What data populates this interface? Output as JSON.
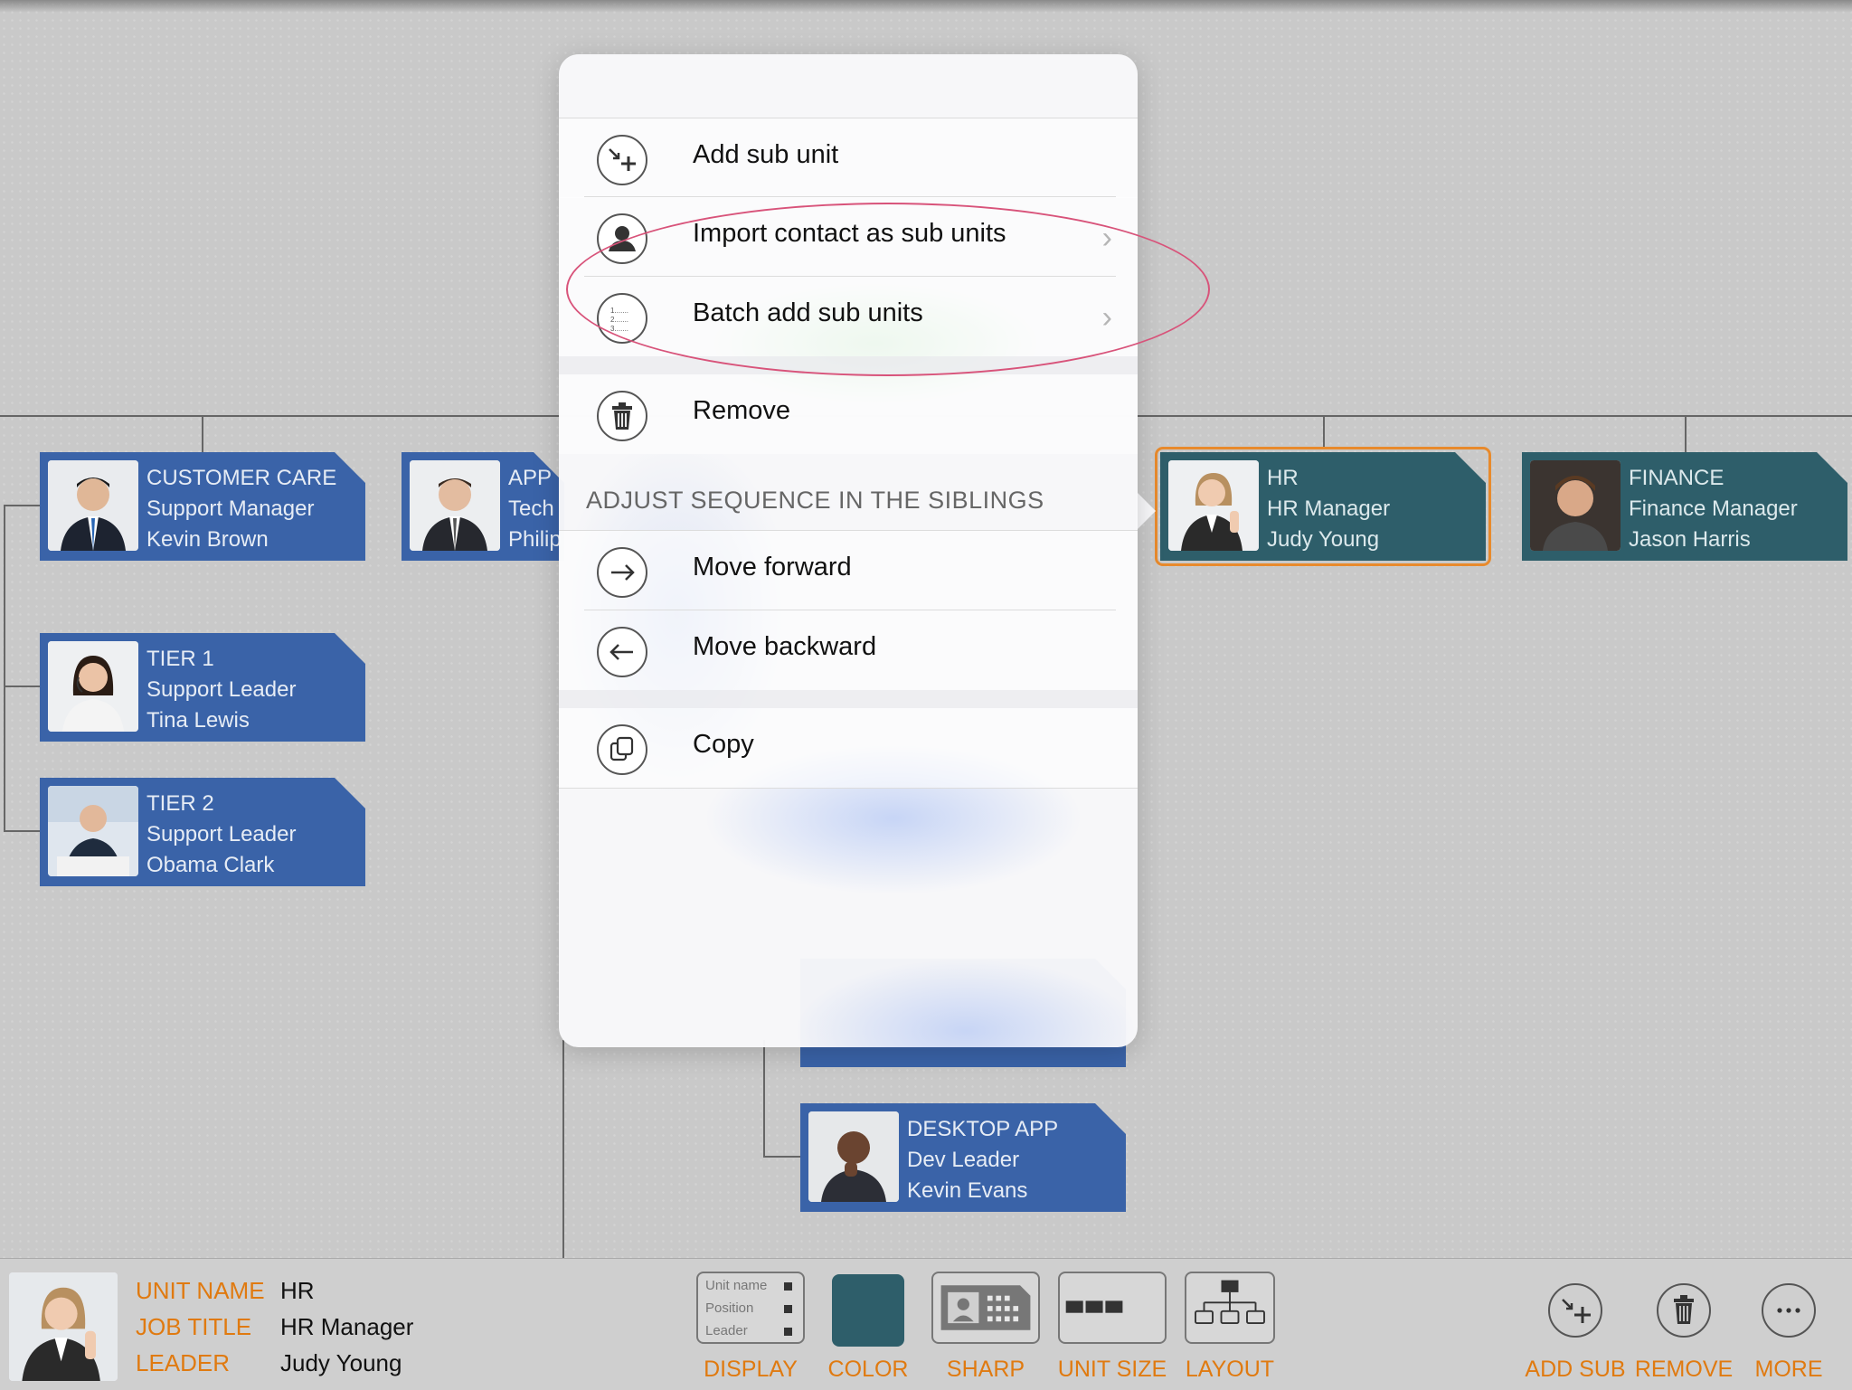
{
  "org": {
    "cards": [
      {
        "unit": "CUSTOMER CARE",
        "position": "Support Manager",
        "leader": "Kevin Brown"
      },
      {
        "unit": "APP",
        "position": "Tech",
        "leader": "Philip"
      },
      {
        "unit": "TIER 1",
        "position": "Support Leader",
        "leader": "Tina Lewis"
      },
      {
        "unit": "TIER 2",
        "position": "Support Leader",
        "leader": "Obama Clark"
      },
      {
        "unit": "HR",
        "position": "HR Manager",
        "leader": "Judy Young"
      },
      {
        "unit": "FINANCE",
        "position": "Finance Manager",
        "leader": "Jason Harris"
      },
      {
        "unit": "DESKTOP APP",
        "position": "Dev Leader",
        "leader": "Kevin Evans"
      }
    ]
  },
  "popover": {
    "items": {
      "add_sub_unit": "Add sub unit",
      "import_contact": "Import contact as sub units",
      "batch_add": "Batch add sub units",
      "remove": "Remove",
      "move_forward": "Move forward",
      "move_backward": "Move backward",
      "copy": "Copy"
    },
    "section_header": "ADJUST SEQUENCE IN THE SIBLINGS"
  },
  "bottombar": {
    "unit_name_key": "UNIT NAME",
    "unit_name_val": "HR",
    "job_title_key": "JOB TITLE",
    "job_title_val": "HR Manager",
    "leader_key": "LEADER",
    "leader_val": "Judy Young",
    "display_preview": {
      "line1": "Unit name",
      "line2": "Position",
      "line3": "Leader"
    },
    "tools": {
      "display": "DISPLAY",
      "color": "COLOR",
      "sharp": "SHARP",
      "unit_size": "UNIT SIZE",
      "layout": "LAYOUT",
      "add_sub": "ADD SUB",
      "remove": "REMOVE",
      "more": "MORE"
    },
    "selected_color": "#2e5e6a"
  },
  "colors": {
    "card_blue": "#3a63a8",
    "card_teal": "#2e5e6a",
    "accent_orange": "#e07a10",
    "highlight_ring": "#d8537a"
  }
}
